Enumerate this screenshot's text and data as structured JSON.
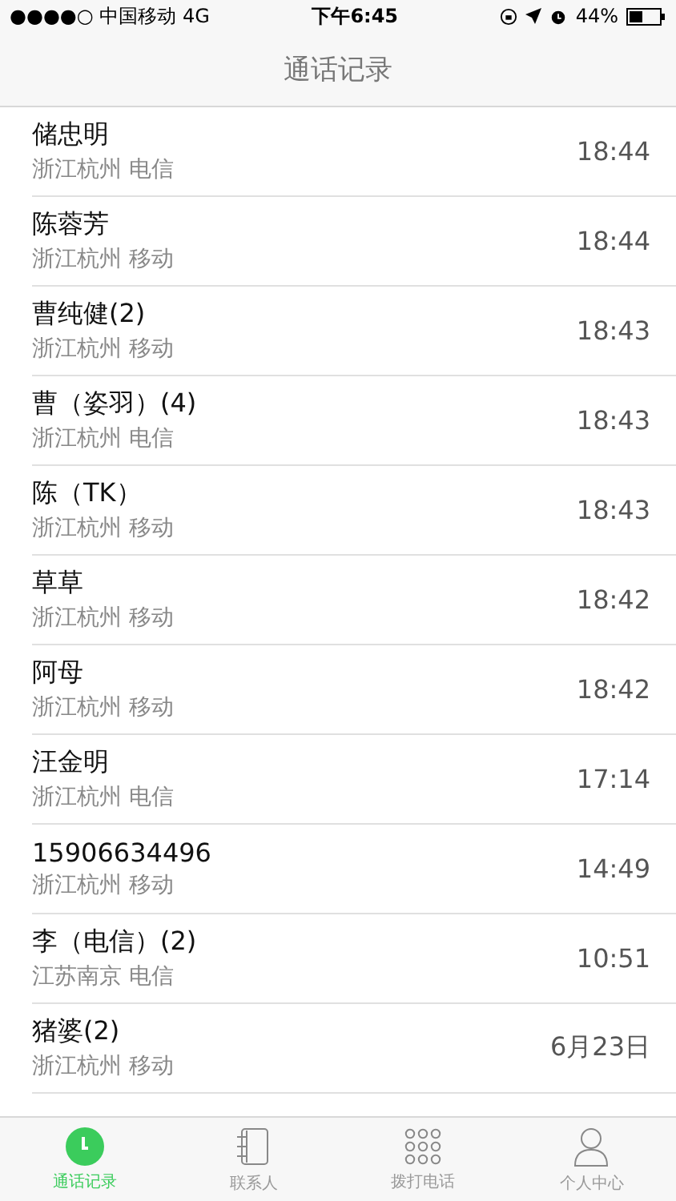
{
  "status_bar": {
    "carrier": "●●●●○ 中国移动  4G",
    "time": "下午6:45",
    "battery": "44%"
  },
  "title": "通话记录",
  "calls": [
    {
      "name": "储忠明",
      "location": "浙江杭州 电信",
      "time": "18:44"
    },
    {
      "name": "陈蓉芳",
      "location": "浙江杭州 移动",
      "time": "18:44"
    },
    {
      "name": "曹纯健(2)",
      "location": "浙江杭州 移动",
      "time": "18:43"
    },
    {
      "name": "曹（姿羽）(4)",
      "location": "浙江杭州 电信",
      "time": "18:43"
    },
    {
      "name": "陈（TK）",
      "location": "浙江杭州 移动",
      "time": "18:43"
    },
    {
      "name": "草草",
      "location": "浙江杭州 移动",
      "time": "18:42"
    },
    {
      "name": "阿母",
      "location": "浙江杭州 移动",
      "time": "18:42"
    },
    {
      "name": "汪金明",
      "location": "浙江杭州 电信",
      "time": "17:14"
    },
    {
      "name": "15906634496",
      "location": "浙江杭州 移动",
      "time": "14:49"
    },
    {
      "name": "李（电信）(2)",
      "location": "江苏南京 电信",
      "time": "10:51"
    },
    {
      "name": "猪婆(2)",
      "location": "浙江杭州 移动",
      "time": "6月23日"
    }
  ],
  "tabs": [
    {
      "kind": "clock",
      "label": "通话记录",
      "selected": true
    },
    {
      "kind": "book",
      "label": "联系人",
      "selected": false
    },
    {
      "kind": "dialpad",
      "label": "拨打电话",
      "selected": false
    },
    {
      "kind": "person",
      "label": "个人中心",
      "selected": false
    }
  ]
}
